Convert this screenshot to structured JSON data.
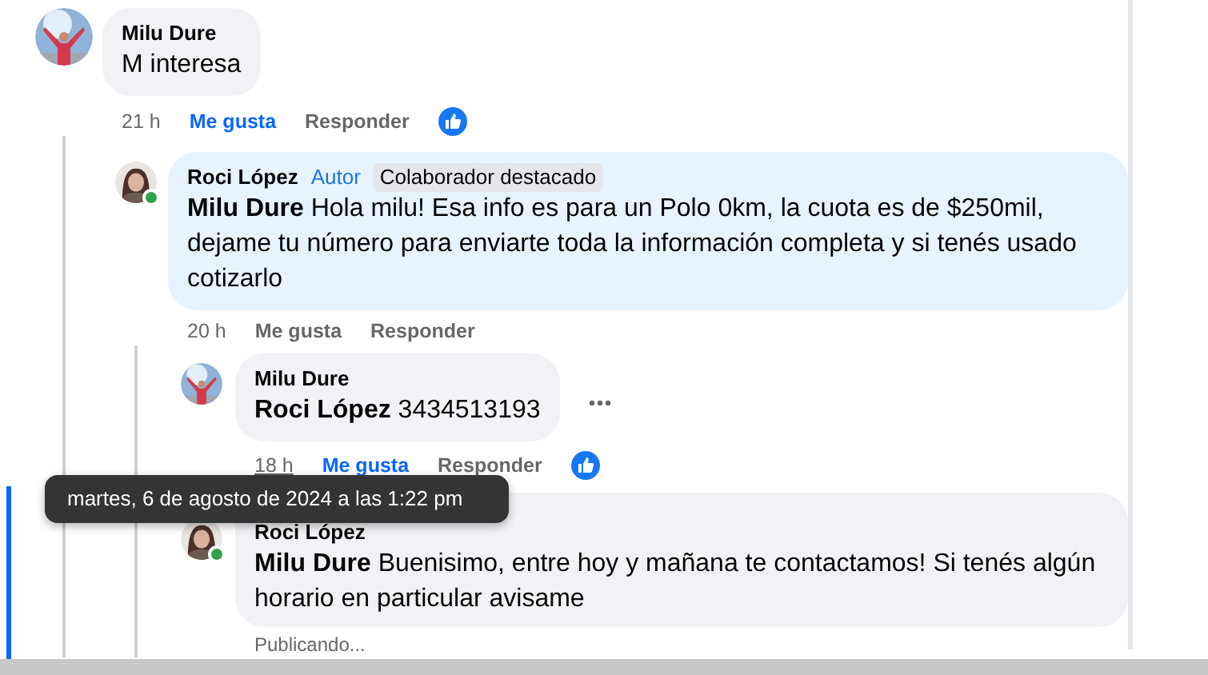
{
  "comments": [
    {
      "author": "Milu Dure",
      "text": "M interesa",
      "time": "21 h",
      "like_label": "Me gusta",
      "reply_label": "Responder",
      "liked": true,
      "reactions": true,
      "children": [
        {
          "author": "Roci López",
          "online": true,
          "badges": [
            {
              "kind": "role",
              "label": "Autor"
            },
            {
              "kind": "tag",
              "label": "Colaborador destacado"
            }
          ],
          "mention": "Milu Dure",
          "text": "Hola milu! Esa info es para un Polo 0km, la cuota es de $250mil, dejame tu número para enviarte toda la información completa y si tenés usado cotizarlo",
          "highlight": true,
          "time": "20 h",
          "like_label": "Me gusta",
          "reply_label": "Responder",
          "liked": false,
          "reactions": false,
          "children": [
            {
              "author": "Milu Dure",
              "mention": "Roci López",
              "text": "3434513193",
              "more_button": true,
              "time": "18 h",
              "time_hovered": true,
              "like_label": "Me gusta",
              "reply_label": "Responder",
              "liked": true,
              "reactions": true
            },
            {
              "author": "Roci López",
              "online": true,
              "mention": "Milu Dure",
              "text": "Buenisimo, entre hoy y mañana te contactamos! Si tenés algún horario en particular avisame",
              "pending": true,
              "status": "Publicando..."
            }
          ]
        }
      ]
    }
  ],
  "tooltip": {
    "text": "martes, 6 de agosto de 2024 a las 1:22 pm"
  }
}
